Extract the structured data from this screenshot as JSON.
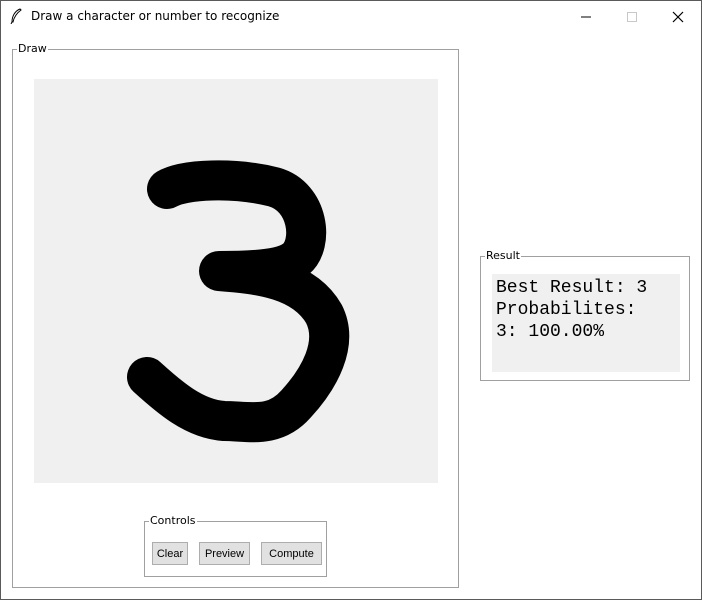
{
  "window": {
    "title": "Draw a character or number to recognize",
    "icon": "feather-icon",
    "controls": [
      "minimize-icon",
      "maximize-icon",
      "close-icon"
    ]
  },
  "draw_panel": {
    "legend": "Draw",
    "canvas_background": "#f0f0f0",
    "stroke_color": "#000000"
  },
  "controls_panel": {
    "legend": "Controls",
    "clear_label": "Clear",
    "preview_label": "Preview",
    "compute_label": "Compute"
  },
  "result_panel": {
    "legend": "Result",
    "lines": [
      "Best Result: 3",
      "Probabilites:",
      "3: 100.00%"
    ]
  }
}
